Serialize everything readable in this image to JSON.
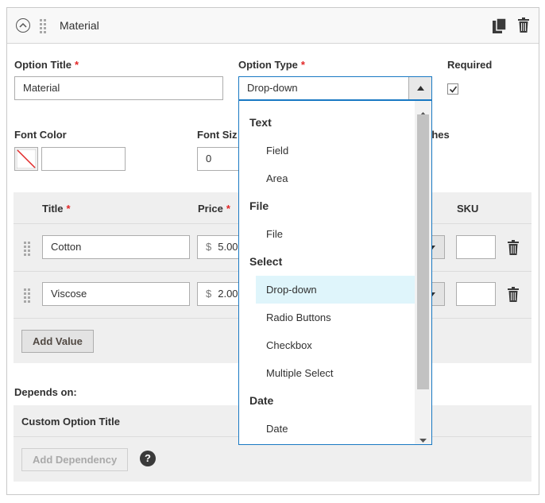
{
  "header": {
    "title": "Material"
  },
  "option_title": {
    "label": "Option Title",
    "required_mark": "*",
    "value": "Material"
  },
  "option_type": {
    "label": "Option Type",
    "required_mark": "*",
    "value": "Drop-down"
  },
  "required": {
    "label": "Required",
    "checked": true
  },
  "font_color": {
    "label": "Font Color",
    "value": ""
  },
  "font_size": {
    "label": "Font Siz",
    "value": "0"
  },
  "hidden_label_fragment": "thes",
  "table": {
    "headers": {
      "title": "Title",
      "title_req": "*",
      "price": "Price",
      "price_req": "*",
      "sku": "SKU"
    },
    "rows": [
      {
        "title": "Cotton",
        "currency": "$",
        "price": "5.00",
        "sku": ""
      },
      {
        "title": "Viscose",
        "currency": "$",
        "price": "2.00",
        "sku": ""
      }
    ],
    "add_value_label": "Add Value"
  },
  "depends_on": {
    "label": "Depends on:",
    "column_title": "Custom Option Title",
    "add_dependency_label": "Add Dependency",
    "help_glyph": "?"
  },
  "dropdown": {
    "items": [
      {
        "type": "group",
        "label": "Text"
      },
      {
        "type": "option",
        "label": "Field"
      },
      {
        "type": "option",
        "label": "Area"
      },
      {
        "type": "group",
        "label": "File"
      },
      {
        "type": "option",
        "label": "File"
      },
      {
        "type": "group",
        "label": "Select"
      },
      {
        "type": "option",
        "label": "Drop-down",
        "selected": true
      },
      {
        "type": "option",
        "label": "Radio Buttons"
      },
      {
        "type": "option",
        "label": "Checkbox"
      },
      {
        "type": "option",
        "label": "Multiple Select"
      },
      {
        "type": "group",
        "label": "Date"
      },
      {
        "type": "option",
        "label": "Date"
      }
    ]
  },
  "colors": {
    "accent": "#1979c3",
    "required": "#e22626",
    "selected_option_bg": "#dff5fb"
  },
  "icons": {
    "collapse": "chevron-up-circle-icon",
    "drag": "drag-handle-icon",
    "copy": "copy-icon",
    "delete": "trash-icon"
  }
}
